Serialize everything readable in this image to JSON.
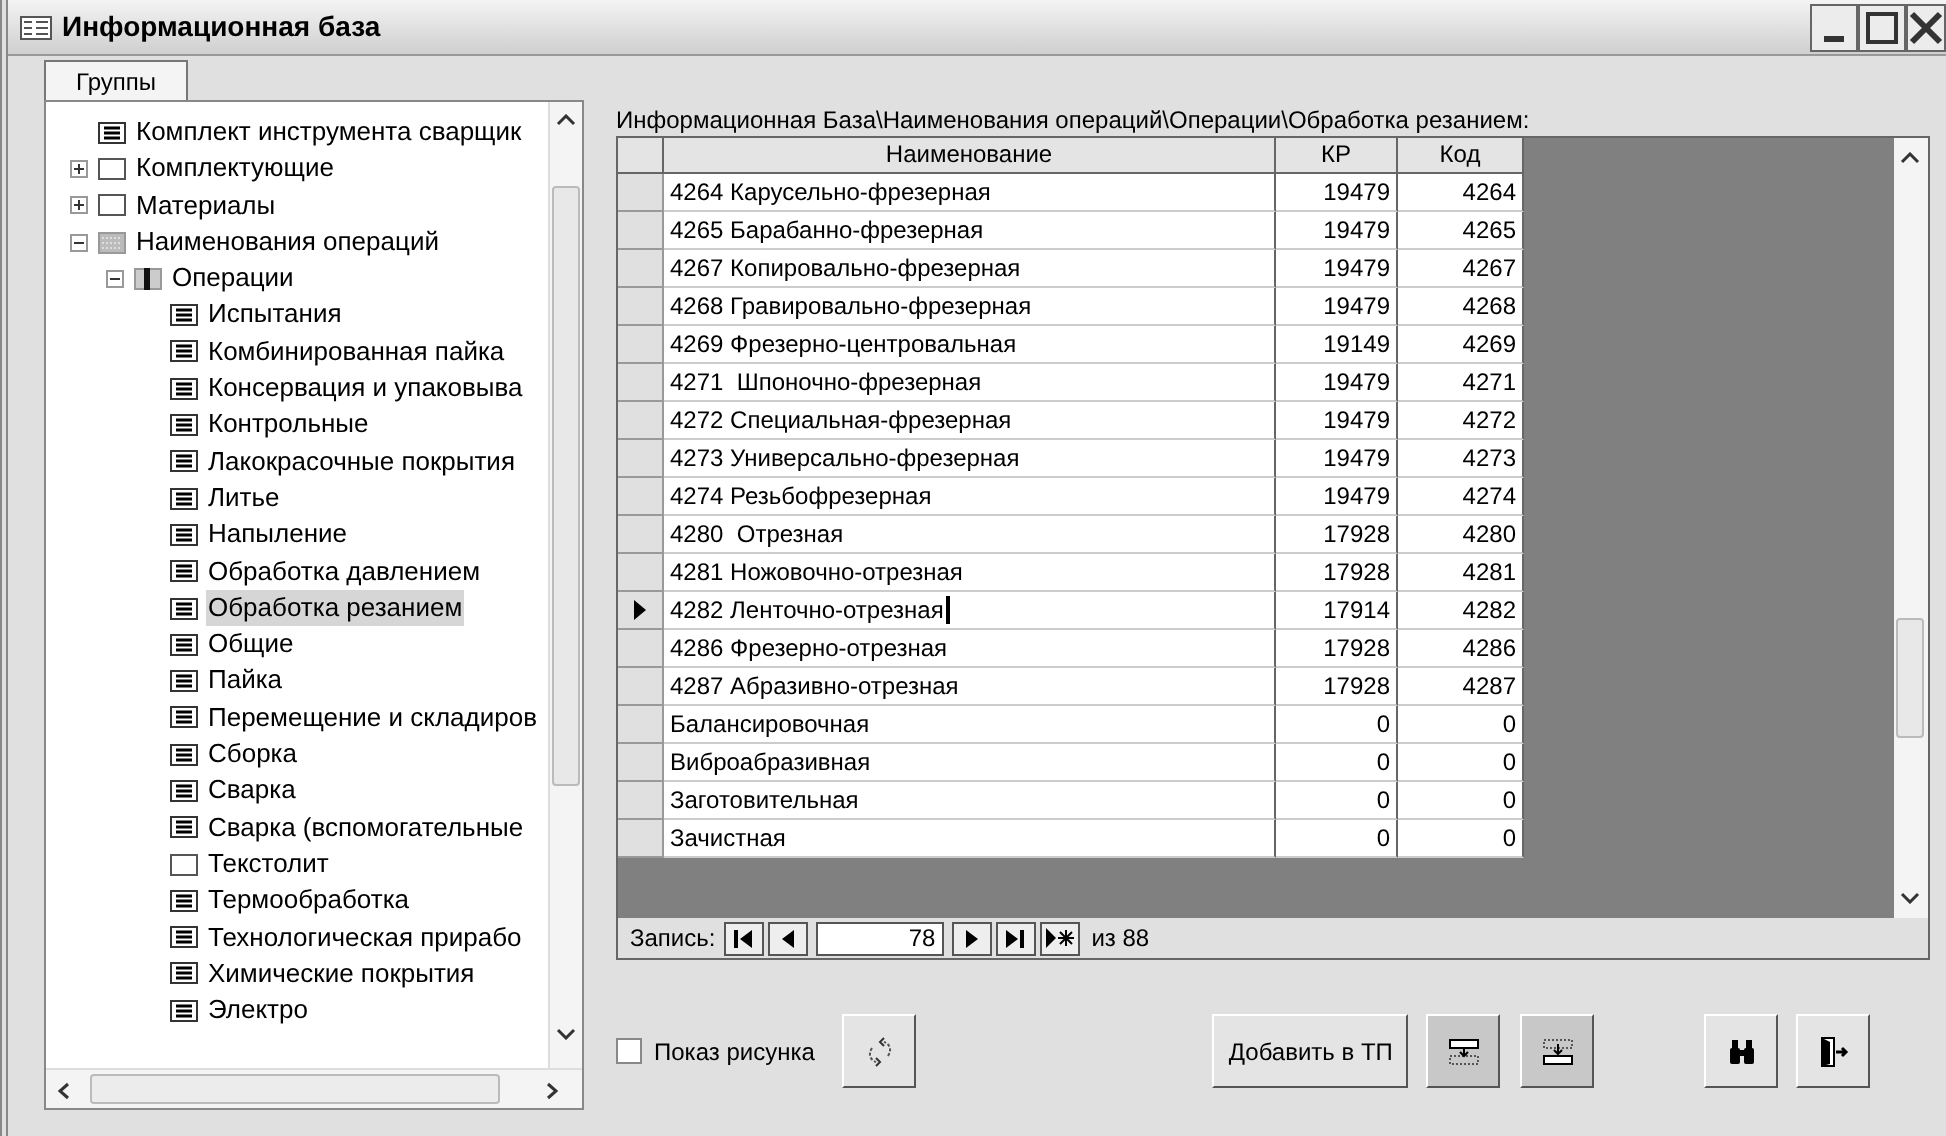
{
  "window": {
    "title": "Информационная база"
  },
  "groups_tab": {
    "label": "Группы",
    "selected": true
  },
  "tree": [
    {
      "label": "Комплект инструмента сварщик",
      "kind": "list",
      "selected": false
    },
    {
      "label": "Комплектующие",
      "kind": "blank",
      "selected": false,
      "expanded": false
    },
    {
      "label": "Материалы",
      "kind": "blank",
      "selected": false,
      "expanded": false
    },
    {
      "label": "Наименования операций",
      "kind": "hatched",
      "selected": false,
      "expanded": true,
      "children": [
        {
          "label": "Операции",
          "kind": "split",
          "selected": false,
          "expanded": true,
          "children": [
            {
              "label": "Испытания",
              "kind": "list",
              "selected": false
            },
            {
              "label": "Комбинированная пайка",
              "kind": "list",
              "selected": false
            },
            {
              "label": "Консервация и упаковыва",
              "kind": "list",
              "selected": false
            },
            {
              "label": "Контрольные",
              "kind": "list",
              "selected": false
            },
            {
              "label": "Лакокрасочные покрытия",
              "kind": "list",
              "selected": false
            },
            {
              "label": "Литье",
              "kind": "list",
              "selected": false
            },
            {
              "label": "Напыление",
              "kind": "list",
              "selected": false
            },
            {
              "label": "Обработка давлением",
              "kind": "list",
              "selected": false
            },
            {
              "label": "Обработка резанием",
              "kind": "list",
              "selected": true
            },
            {
              "label": "Общие",
              "kind": "list",
              "selected": false
            },
            {
              "label": "Пайка",
              "kind": "list",
              "selected": false
            },
            {
              "label": "Перемещение и складиров",
              "kind": "list",
              "selected": false
            },
            {
              "label": "Сборка",
              "kind": "list",
              "selected": false
            },
            {
              "label": "Сварка",
              "kind": "list",
              "selected": false
            },
            {
              "label": "Сварка (вспомогательные",
              "kind": "list",
              "selected": false
            },
            {
              "label": "Текстолит",
              "kind": "blank",
              "selected": false
            },
            {
              "label": "Термообработка",
              "kind": "list",
              "selected": false
            },
            {
              "label": "Технологическая прирабо",
              "kind": "list",
              "selected": false
            },
            {
              "label": "Химические покрытия",
              "kind": "list",
              "selected": false
            },
            {
              "label": "Электро",
              "kind": "list",
              "selected": false
            }
          ]
        }
      ]
    }
  ],
  "path": "Информационная База\\Наименования операций\\Операции\\Обработка резанием:",
  "table": {
    "columns": [
      "Наименование",
      "КР",
      "Код"
    ],
    "rows": [
      {
        "name": "4264 Карусельно-фрезерная",
        "kr": "19479",
        "code": "4264",
        "selected": false
      },
      {
        "name": "4265 Барабанно-фрезерная",
        "kr": "19479",
        "code": "4265",
        "selected": false
      },
      {
        "name": "4267 Копировально-фрезерная",
        "kr": "19479",
        "code": "4267",
        "selected": false
      },
      {
        "name": "4268 Гравировально-фрезерная",
        "kr": "19479",
        "code": "4268",
        "selected": false
      },
      {
        "name": "4269 Фрезерно-центровальная",
        "kr": "19149",
        "code": "4269",
        "selected": false
      },
      {
        "name": "4271  Шпоночно-фрезерная",
        "kr": "19479",
        "code": "4271",
        "selected": false
      },
      {
        "name": "4272 Специальная-фрезерная",
        "kr": "19479",
        "code": "4272",
        "selected": false
      },
      {
        "name": "4273 Универсально-фрезерная",
        "kr": "19479",
        "code": "4273",
        "selected": false
      },
      {
        "name": "4274 Резьбофрезерная",
        "kr": "19479",
        "code": "4274",
        "selected": false
      },
      {
        "name": "4280  Отрезная",
        "kr": "17928",
        "code": "4280",
        "selected": false
      },
      {
        "name": "4281 Ножовочно-отрезная",
        "kr": "17928",
        "code": "4281",
        "selected": false
      },
      {
        "name": "4282 Ленточно-отрезная",
        "kr": "17914",
        "code": "4282",
        "selected": true
      },
      {
        "name": "4286 Фрезерно-отрезная",
        "kr": "17928",
        "code": "4286",
        "selected": false
      },
      {
        "name": "4287 Абразивно-отрезная",
        "kr": "17928",
        "code": "4287",
        "selected": false
      },
      {
        "name": "Балансировочная",
        "kr": "0",
        "code": "0",
        "selected": false
      },
      {
        "name": "Виброабразивная",
        "kr": "0",
        "code": "0",
        "selected": false
      },
      {
        "name": "Заготовительная",
        "kr": "0",
        "code": "0",
        "selected": false
      },
      {
        "name": "Зачистная",
        "kr": "0",
        "code": "0",
        "selected": false
      }
    ]
  },
  "navigator": {
    "label": "Запись:",
    "record": "78",
    "total": "из 88"
  },
  "show_picture": {
    "label": "Показ рисунка",
    "checked": false
  },
  "buttons": [
    {
      "kind": "swap"
    },
    {
      "kind": "text",
      "label": "Добавить в ТП"
    },
    {
      "kind": "insert-below",
      "pressed": true
    },
    {
      "kind": "insert-above",
      "pressed": true
    },
    {
      "kind": "find"
    },
    {
      "kind": "exit"
    }
  ]
}
